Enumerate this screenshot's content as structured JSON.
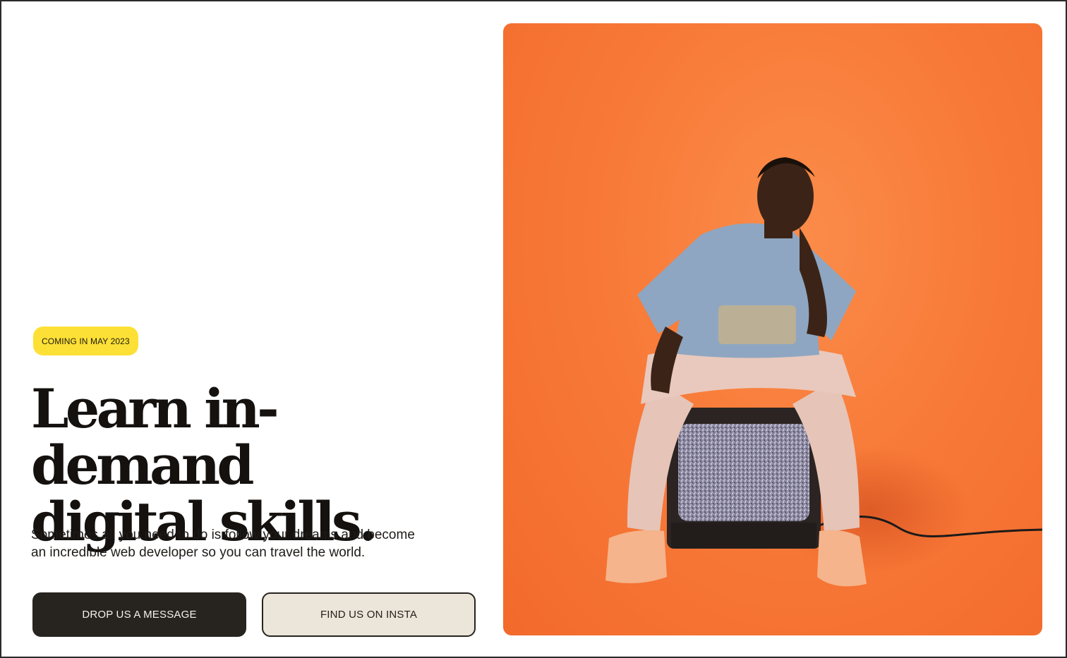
{
  "hero": {
    "badge": "COMING IN MAY 2023",
    "title_line1": "Learn in-demand",
    "title_line2": "digital skills.",
    "subtitle_line1": "Sometimes all you need to do is follow your dreams and become",
    "subtitle_line2": "an incredible web developer so you can travel the world.",
    "primary_button": "DROP US A MESSAGE",
    "secondary_button": "FIND US ON INSTA"
  },
  "colors": {
    "badge": "#fde035",
    "primary_button": "#272420",
    "secondary_button": "#ece5d9",
    "photo_background": "#f87a38"
  }
}
